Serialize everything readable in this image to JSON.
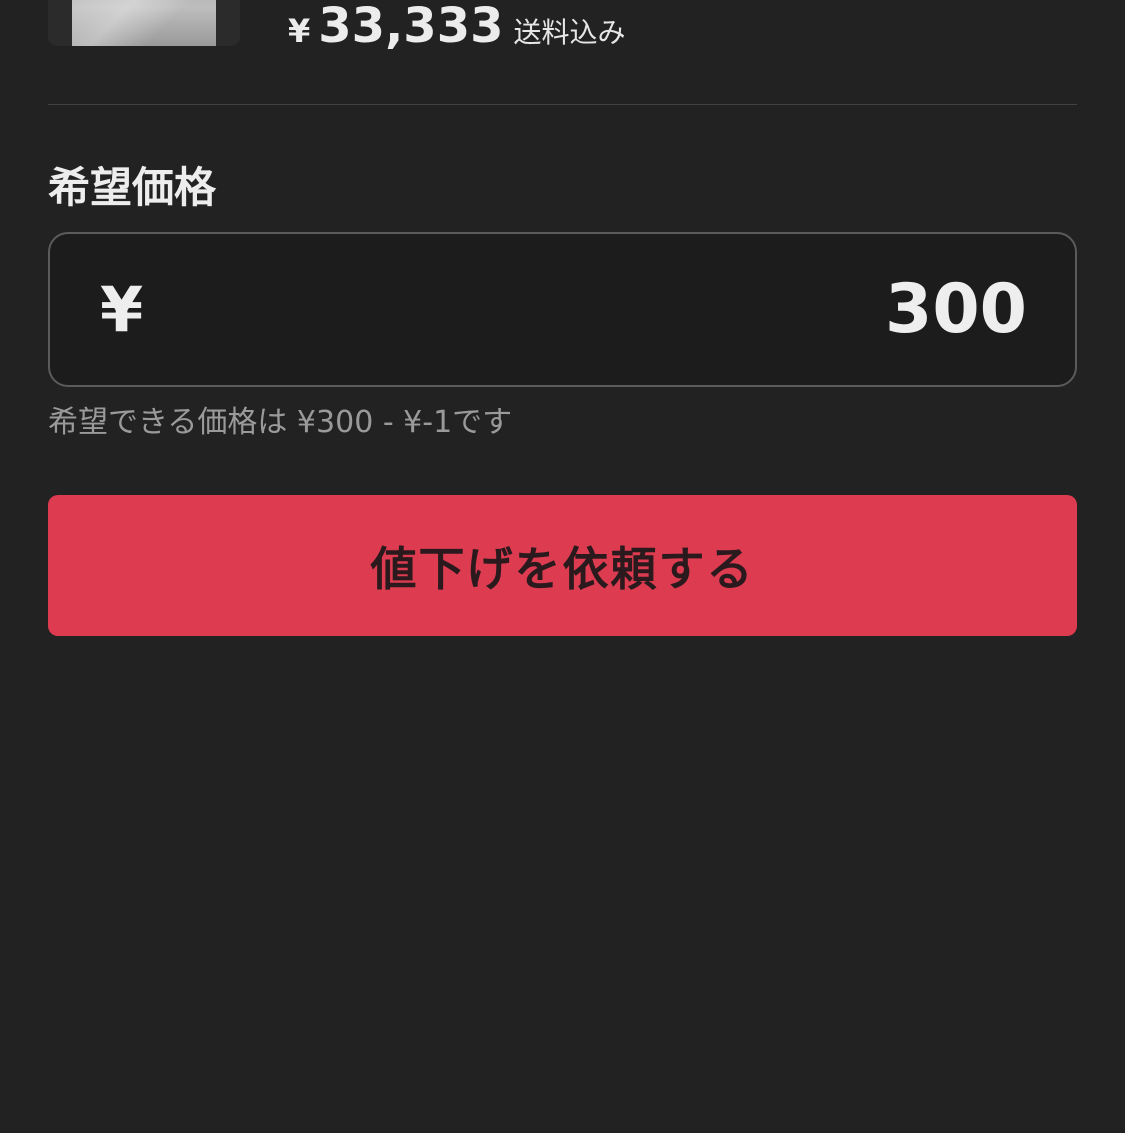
{
  "item": {
    "price_currency": "¥",
    "price_value": "33,333",
    "price_note": "送料込み"
  },
  "offer": {
    "title": "希望価格",
    "input_currency": "¥",
    "input_value": "300",
    "helper_text": "希望できる価格は ¥300 - ¥-1です"
  },
  "actions": {
    "submit_label": "値下げを依頼する"
  },
  "colors": {
    "background": "#222222",
    "button": "#dc3b50",
    "input_border": "#5b5b5b",
    "helper_text": "#9a9a9a"
  }
}
